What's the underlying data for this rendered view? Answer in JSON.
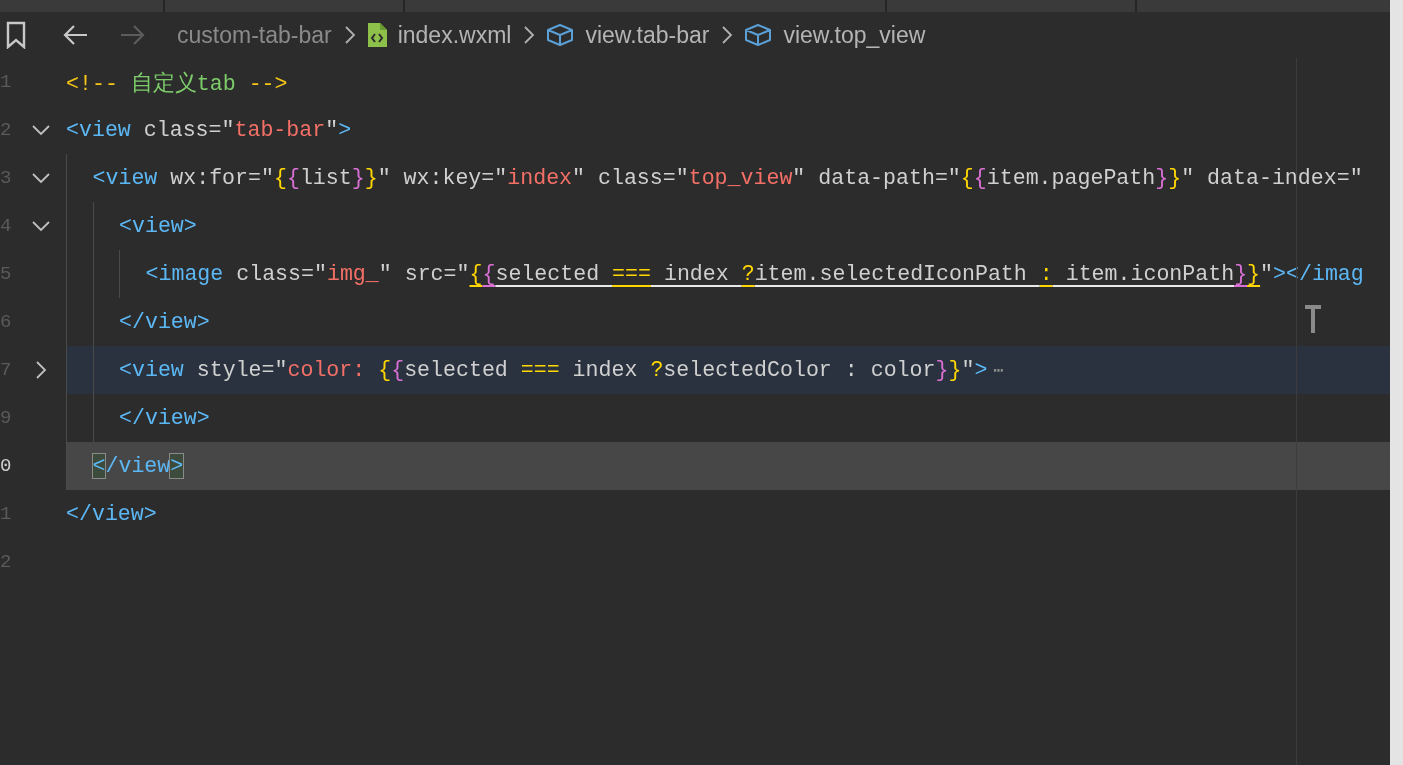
{
  "navigation": [
    {
      "kind": "back",
      "disabled": false
    },
    {
      "kind": "forward",
      "disabled": true
    }
  ],
  "breadcrumbs": [
    {
      "label": "custom-tab-bar",
      "kind": "folder"
    },
    {
      "label": "index.wxml",
      "kind": "file"
    },
    {
      "label": "view.tab-bar",
      "kind": "element"
    },
    {
      "label": "view.top_view",
      "kind": "element"
    }
  ],
  "lines": [
    {
      "number": "1",
      "current": false,
      "selected": false,
      "tokens": [
        {
          "t": "<!-- ",
          "kind": "cp"
        },
        {
          "t": "自定义tab",
          "kind": "ct"
        },
        {
          "t": " -->",
          "kind": "cp"
        }
      ]
    },
    {
      "number": "2",
      "current": false,
      "selected": false,
      "folded": false,
      "tokens": [
        {
          "t": "<view",
          "kind": "tag"
        },
        {
          "t": " class=\"",
          "kind": "plain"
        },
        {
          "t": "tab-bar",
          "kind": "str"
        },
        {
          "t": "\"",
          "kind": "plain"
        },
        {
          "t": ">",
          "kind": "tag"
        }
      ],
      "children": [
        {
          "number": "3",
          "current": false,
          "selected": false,
          "folded": false,
          "tokens": [
            {
              "t": "<view",
              "kind": "tag"
            },
            {
              "t": " wx:for=\"",
              "kind": "plain"
            },
            {
              "t": "{",
              "kind": "b1"
            },
            {
              "t": "{",
              "kind": "b2"
            },
            {
              "t": "list",
              "kind": "plain"
            },
            {
              "t": "}",
              "kind": "b2"
            },
            {
              "t": "}",
              "kind": "b1"
            },
            {
              "t": "\" wx:key=\"",
              "kind": "plain"
            },
            {
              "t": "index",
              "kind": "str"
            },
            {
              "t": "\" class=\"",
              "kind": "plain"
            },
            {
              "t": "top_view",
              "kind": "str"
            },
            {
              "t": "\" data-path=\"",
              "kind": "plain"
            },
            {
              "t": "{",
              "kind": "b1"
            },
            {
              "t": "{",
              "kind": "b2"
            },
            {
              "t": "item.pagePath",
              "kind": "plain"
            },
            {
              "t": "}",
              "kind": "b2"
            },
            {
              "t": "}",
              "kind": "b1"
            },
            {
              "t": "\" data-index=\"",
              "kind": "plain"
            }
          ],
          "children": [
            {
              "number": "4",
              "current": false,
              "selected": false,
              "folded": false,
              "tokens": [
                {
                  "t": "<view>",
                  "kind": "tag"
                }
              ],
              "children": [
                {
                  "number": "5",
                  "current": false,
                  "selected": false,
                  "tokens": [
                    {
                      "t": "<image",
                      "kind": "tag"
                    },
                    {
                      "t": " class=\"",
                      "kind": "plain"
                    },
                    {
                      "t": "img_",
                      "kind": "str"
                    },
                    {
                      "t": "\" src=\"",
                      "kind": "plain"
                    },
                    {
                      "t": "{",
                      "kind": "b1",
                      "underlined": true
                    },
                    {
                      "t": "{",
                      "kind": "b2",
                      "underlined": true
                    },
                    {
                      "t": "selected ",
                      "kind": "plain",
                      "underlined": true
                    },
                    {
                      "t": "===",
                      "kind": "op",
                      "underlined": true
                    },
                    {
                      "t": " index ",
                      "kind": "plain",
                      "underlined": true
                    },
                    {
                      "t": "?",
                      "kind": "op",
                      "underlined": true
                    },
                    {
                      "t": "item.selectedIconPath ",
                      "kind": "plain",
                      "underlined": true
                    },
                    {
                      "t": ":",
                      "kind": "op",
                      "underlined": true
                    },
                    {
                      "t": " item.iconPath",
                      "kind": "plain",
                      "underlined": true
                    },
                    {
                      "t": "}",
                      "kind": "b2",
                      "underlined": true
                    },
                    {
                      "t": "}",
                      "kind": "b1",
                      "underlined": true
                    },
                    {
                      "t": "\"",
                      "kind": "plain"
                    },
                    {
                      "t": "></imag",
                      "kind": "tag"
                    }
                  ]
                }
              ]
            },
            {
              "number": "6",
              "current": false,
              "selected": false,
              "tokens": [
                {
                  "t": "</view>",
                  "kind": "tag"
                }
              ]
            },
            {
              "number": "7",
              "current": false,
              "selected": true,
              "folded": true,
              "ellipsis": "⋯",
              "tokens": [
                {
                  "t": "<view",
                  "kind": "tag"
                },
                {
                  "t": " style=\"",
                  "kind": "plain"
                },
                {
                  "t": "color: ",
                  "kind": "str"
                },
                {
                  "t": "{",
                  "kind": "b1"
                },
                {
                  "t": "{",
                  "kind": "b2"
                },
                {
                  "t": "selected ",
                  "kind": "plain"
                },
                {
                  "t": "===",
                  "kind": "op"
                },
                {
                  "t": " index ",
                  "kind": "plain"
                },
                {
                  "t": "?",
                  "kind": "op"
                },
                {
                  "t": "selectedColor : color",
                  "kind": "plain"
                },
                {
                  "t": "}",
                  "kind": "b2"
                },
                {
                  "t": "}",
                  "kind": "b1"
                },
                {
                  "t": "\"",
                  "kind": "plain"
                },
                {
                  "t": ">",
                  "kind": "tag"
                }
              ]
            },
            {
              "number": "9",
              "current": false,
              "selected": false,
              "tokens": [
                {
                  "t": "</view>",
                  "kind": "tag"
                }
              ]
            }
          ]
        },
        {
          "number": "0",
          "current": true,
          "selected": false,
          "tokens": [
            {
              "t": "<",
              "kind": "tag",
              "matched": true
            },
            {
              "t": "/view",
              "kind": "tag"
            },
            {
              "t": ">",
              "kind": "tag",
              "matched": true
            }
          ]
        }
      ]
    },
    {
      "number": "1",
      "current": false,
      "selected": false,
      "tokens": [
        {
          "t": "</view>",
          "kind": "tag"
        }
      ]
    },
    {
      "number": "2",
      "current": false,
      "selected": false
    }
  ]
}
